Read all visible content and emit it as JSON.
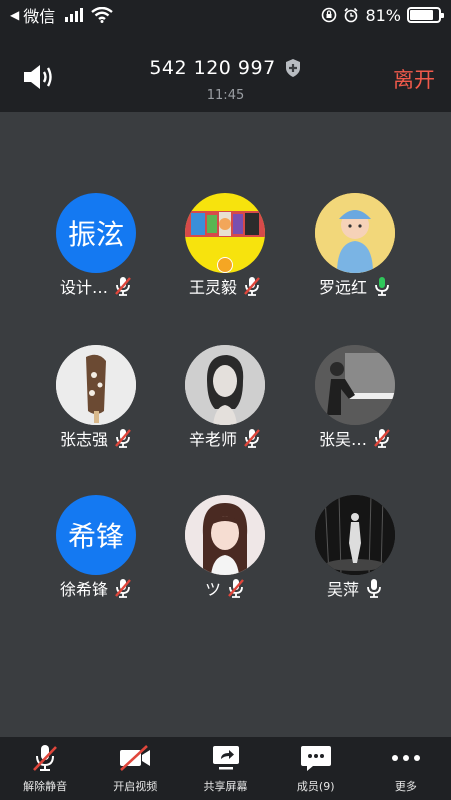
{
  "status_bar": {
    "back_app": "微信",
    "battery": "81%",
    "battery_level": 0.81
  },
  "header": {
    "meeting_id": "542 120 997",
    "time": "11:45",
    "leave_label": "离开"
  },
  "participants": [
    {
      "name": "设计…",
      "avatar_text": "振泫",
      "mic": "muted"
    },
    {
      "name": "王灵毅",
      "avatar_text": "",
      "mic": "muted",
      "host": true
    },
    {
      "name": "罗远红",
      "avatar_text": "",
      "mic": "active"
    },
    {
      "name": "张志强",
      "avatar_text": "",
      "mic": "muted"
    },
    {
      "name": "辛老师",
      "avatar_text": "",
      "mic": "muted"
    },
    {
      "name": "张吴…",
      "avatar_text": "",
      "mic": "muted"
    },
    {
      "name": "徐希锋",
      "avatar_text": "希锋",
      "mic": "muted"
    },
    {
      "name": "ツ",
      "avatar_text": "",
      "mic": "muted"
    },
    {
      "name": "吴萍",
      "avatar_text": "",
      "mic": "on"
    }
  ],
  "toolbar": {
    "unmute": "解除静音",
    "video": "开启视频",
    "share": "共享屏幕",
    "members": "成员(9)",
    "more": "更多"
  },
  "colors": {
    "accent_blue": "#1479f2",
    "leave_red": "#f05a4b",
    "mic_muted_red": "#e0463b",
    "mic_active_green": "#2fc65a"
  }
}
